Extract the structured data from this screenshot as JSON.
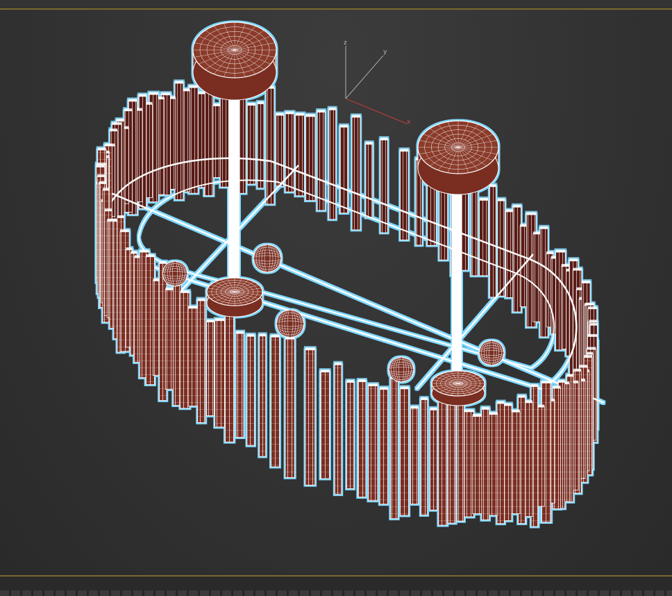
{
  "viewport": {
    "axes": {
      "x_label": "x",
      "y_label": "y",
      "z_label": "z"
    }
  },
  "colors": {
    "background": "#2b2b2b",
    "viewport_bg": "#343434",
    "frame_accent": "#7a6a2e",
    "mesh_fill": "#7a2e22",
    "wireframe": "#ffffff",
    "selection_outline": "#7fd8ff",
    "x_axis": "#c83a3a",
    "other_axes": "#bdbdbd"
  },
  "model": {
    "name_icon": "chandelier-wireframe-icon",
    "pendant_disc_icon": "ceiling-canopy-icon",
    "sphere_icon": "bulb-sphere-icon"
  }
}
